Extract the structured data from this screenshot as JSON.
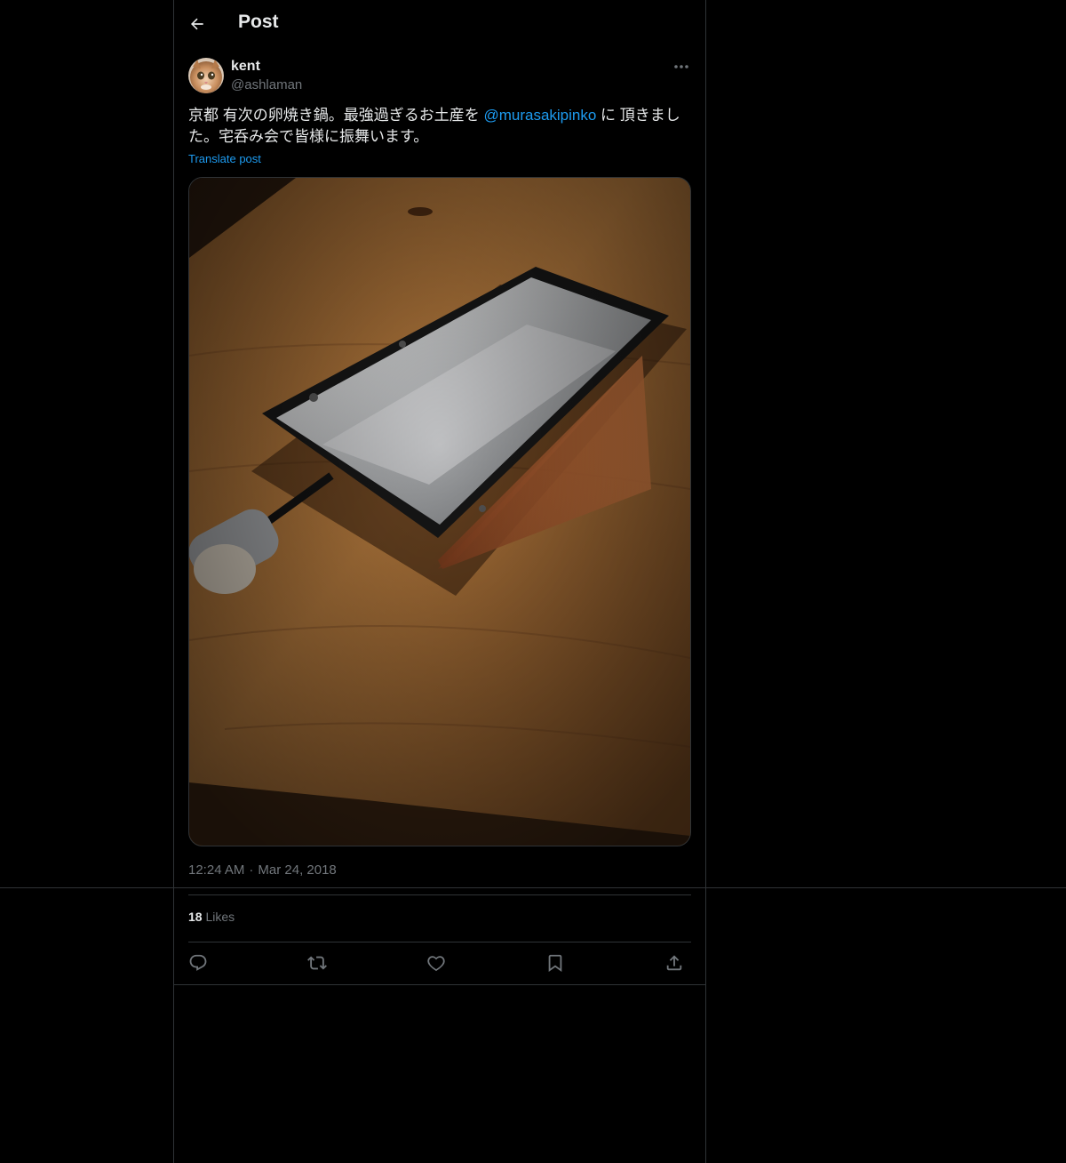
{
  "header": {
    "title": "Post",
    "back_icon": "arrow-left-icon"
  },
  "post": {
    "author": {
      "name": "kent",
      "handle": "@ashlaman"
    },
    "more_icon": "more-horizontal-icon",
    "text_before": "京都 有次の卵焼き鍋。最強過ぎるお土産を ",
    "mention": "@murasakipinko",
    "text_after": " に 頂きました。宅呑み会で皆様に振舞います。",
    "translate_label": "Translate post",
    "time": "12:24 AM",
    "separator": "·",
    "date": "Mar 24, 2018",
    "likes_count": "18",
    "likes_label": "Likes"
  },
  "actions": [
    {
      "name": "reply",
      "icon": "reply-icon"
    },
    {
      "name": "repost",
      "icon": "repost-icon"
    },
    {
      "name": "like",
      "icon": "heart-icon"
    },
    {
      "name": "bookmark",
      "icon": "bookmark-icon"
    },
    {
      "name": "share",
      "icon": "share-icon"
    }
  ],
  "colors": {
    "background": "#000000",
    "text": "#e7e9ea",
    "secondary_text": "#71767b",
    "link": "#1d9bf0",
    "border": "#2f3336"
  }
}
